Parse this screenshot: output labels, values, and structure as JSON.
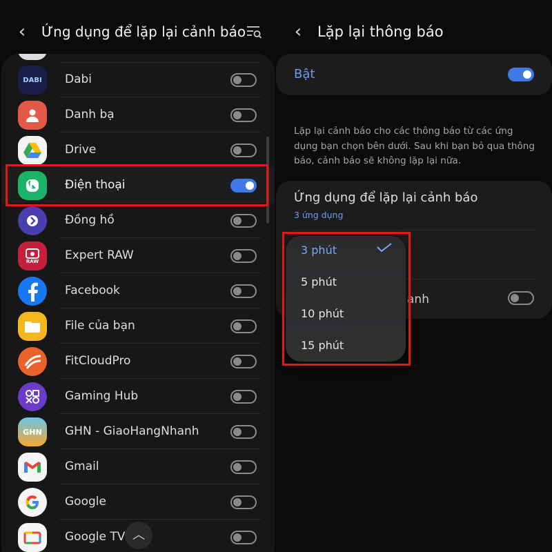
{
  "left": {
    "title": "Ứng dụng để lặp lại cảnh báo",
    "apps": [
      {
        "name": "Dabi",
        "on": false,
        "icon": "dabi-icon"
      },
      {
        "name": "Danh bạ",
        "on": false,
        "icon": "contacts-icon"
      },
      {
        "name": "Drive",
        "on": false,
        "icon": "drive-icon"
      },
      {
        "name": "Điện thoại",
        "on": true,
        "icon": "phone-icon"
      },
      {
        "name": "Đồng hồ",
        "on": false,
        "icon": "clock-icon"
      },
      {
        "name": "Expert RAW",
        "on": false,
        "icon": "expert-raw-icon"
      },
      {
        "name": "Facebook",
        "on": false,
        "icon": "facebook-icon"
      },
      {
        "name": "File của bạn",
        "on": false,
        "icon": "folder-icon"
      },
      {
        "name": "FitCloudPro",
        "on": false,
        "icon": "fitcloudpro-icon"
      },
      {
        "name": "Gaming Hub",
        "on": false,
        "icon": "gaming-hub-icon"
      },
      {
        "name": "GHN - GiaoHangNhanh",
        "on": false,
        "icon": "ghn-icon"
      },
      {
        "name": "Gmail",
        "on": false,
        "icon": "gmail-icon"
      },
      {
        "name": "Google",
        "on": false,
        "icon": "google-icon"
      },
      {
        "name": "Google TV",
        "on": false,
        "icon": "google-tv-icon"
      }
    ],
    "icon_text": {
      "dabi": "DABI",
      "raw": "RAW",
      "ghn": "GHN"
    }
  },
  "right": {
    "title": "Lặp lại thông báo",
    "bat_label": "Bật",
    "bat_on": true,
    "description": "Lặp lại cảnh báo cho các thông báo từ các ứng dụng bạn chọn bên dưới. Sau khi bạn bỏ qua thông báo, cảnh báo sẽ không lặp lại nữa.",
    "apps_section": {
      "title": "Ứng dụng để lặp lại cảnh báo",
      "count": "3 ứng dụng"
    },
    "partial_text": "anh",
    "dropdown": {
      "selected_index": 0,
      "options": [
        "3 phút",
        "5 phút",
        "10 phút",
        "15 phút"
      ]
    }
  },
  "colors": {
    "accent": "#3e79e6",
    "accent_text": "#6e9bf2",
    "highlight": "#e11818"
  }
}
